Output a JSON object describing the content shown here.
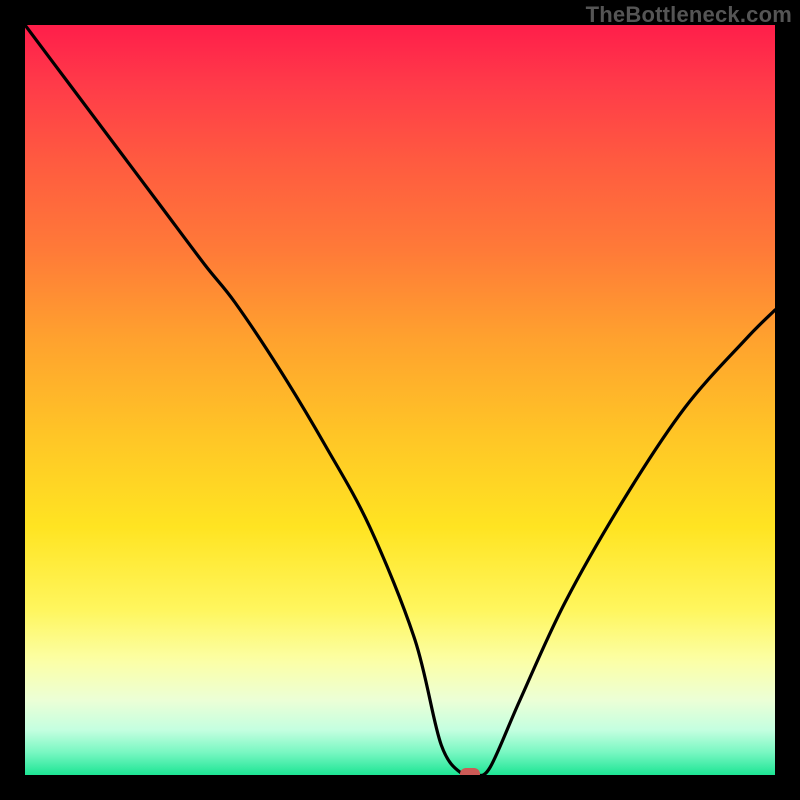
{
  "watermark": "TheBottleneck.com",
  "colors": {
    "frame": "#000000",
    "curve_stroke": "#000000",
    "marker": "#cc5a56",
    "gradient_top": "#ff1e4a",
    "gradient_bottom": "#1de594"
  },
  "chart_data": {
    "type": "line",
    "title": "",
    "xlabel": "",
    "ylabel": "",
    "xlim": [
      0,
      100
    ],
    "ylim": [
      0,
      100
    ],
    "grid": false,
    "legend": false,
    "series": [
      {
        "name": "bottleneck-curve",
        "x": [
          0,
          6,
          12,
          18,
          24,
          28,
          34,
          40,
          46,
          52,
          55.5,
          58.5,
          60,
          62,
          66,
          72,
          80,
          88,
          96,
          100
        ],
        "values": [
          100,
          92,
          84,
          76,
          68,
          63,
          54,
          44,
          33,
          18,
          4,
          0,
          0,
          1,
          10,
          23,
          37,
          49,
          58,
          62
        ]
      }
    ],
    "annotations": [
      {
        "type": "marker",
        "x": 59.3,
        "y": 0.2,
        "label": "optimal-point"
      }
    ]
  }
}
